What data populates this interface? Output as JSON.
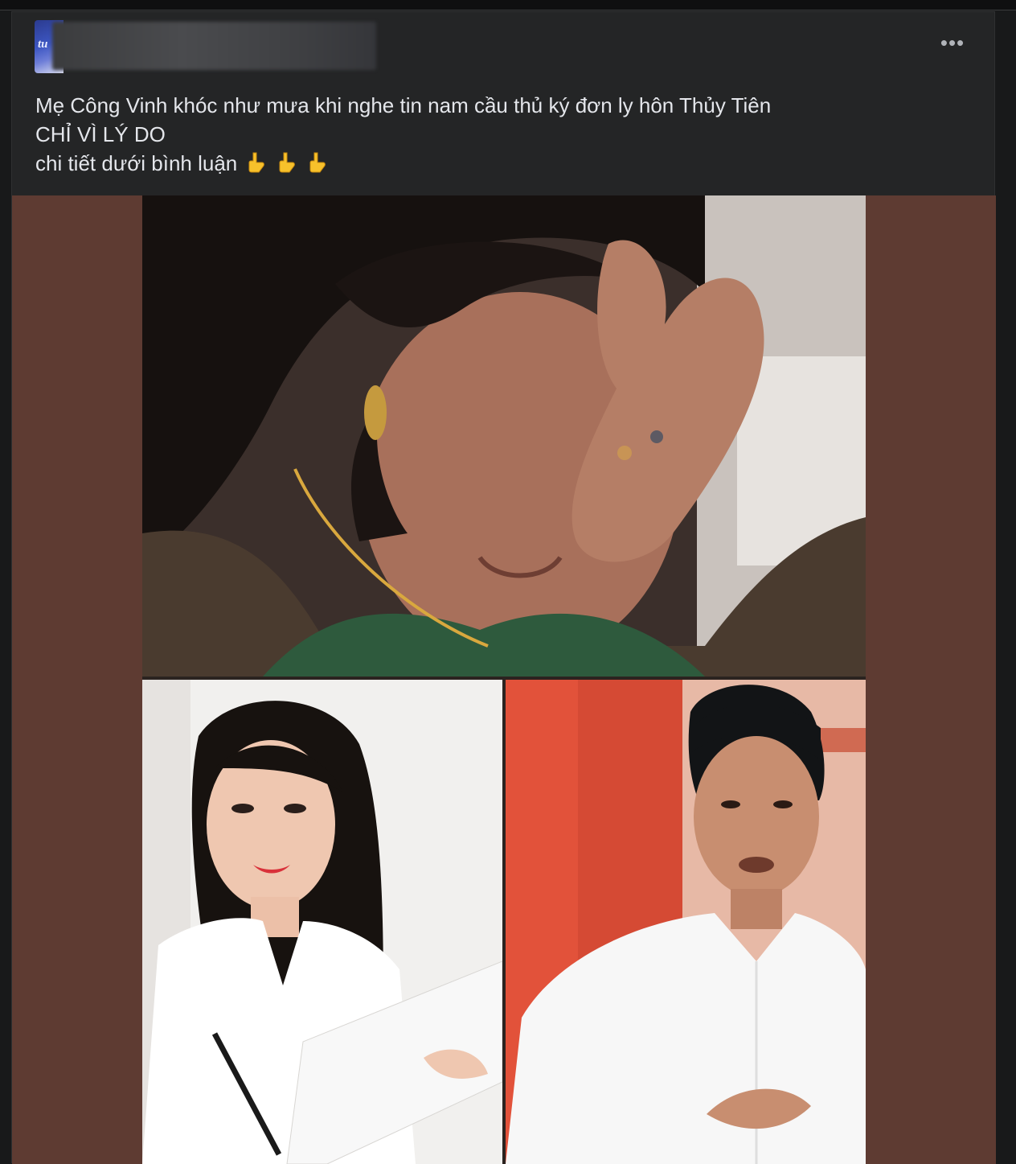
{
  "post": {
    "avatar_text": "tu",
    "more_options": "•••",
    "caption_lines": [
      "Mẹ Công Vinh khóc như mưa khi nghe tin nam cầu thủ ký đơn ly hôn Thủy Tiên",
      "CHỈ VÌ LÝ DO",
      "chi tiết dưới bình luận"
    ],
    "pointing_emoji": [
      "point-down-icon",
      "point-down-icon",
      "point-down-icon"
    ]
  },
  "colors": {
    "page_bg": "#18191a",
    "card_bg": "#242526",
    "text": "#e4e6eb",
    "media_bg": "#5e3b32"
  }
}
